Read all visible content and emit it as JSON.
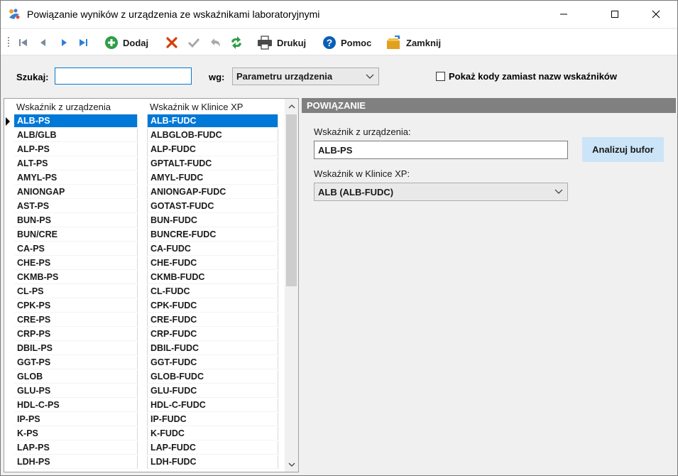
{
  "window": {
    "title": "Powiązanie wyników z urządzenia ze wskaźnikami laboratoryjnymi"
  },
  "toolbar": {
    "add_label": "Dodaj",
    "print_label": "Drukuj",
    "help_label": "Pomoc",
    "close_label": "Zamknij"
  },
  "search": {
    "label": "Szukaj:",
    "value": "",
    "by_label": "wg:",
    "by_value": "Parametru urządzenia",
    "show_codes_label": "Pokaż kody zamiast nazw wskaźników",
    "show_codes_checked": false
  },
  "grid": {
    "columns": [
      "Wskaźnik z urządzenia",
      "Wskaźnik w Klinice XP"
    ],
    "selected_index": 0,
    "rows": [
      [
        "ALB-PS",
        "ALB-FUDC"
      ],
      [
        "ALB/GLB",
        "ALBGLOB-FUDC"
      ],
      [
        "ALP-PS",
        "ALP-FUDC"
      ],
      [
        "ALT-PS",
        "GPTALT-FUDC"
      ],
      [
        "AMYL-PS",
        "AMYL-FUDC"
      ],
      [
        "ANIONGAP",
        "ANIONGAP-FUDC"
      ],
      [
        "AST-PS",
        "GOTAST-FUDC"
      ],
      [
        "BUN-PS",
        "BUN-FUDC"
      ],
      [
        "BUN/CRE",
        "BUNCRE-FUDC"
      ],
      [
        "CA-PS",
        "CA-FUDC"
      ],
      [
        "CHE-PS",
        "CHE-FUDC"
      ],
      [
        "CKMB-PS",
        "CKMB-FUDC"
      ],
      [
        "CL-PS",
        "CL-FUDC"
      ],
      [
        "CPK-PS",
        "CPK-FUDC"
      ],
      [
        "CRE-PS",
        "CRE-FUDC"
      ],
      [
        "CRP-PS",
        "CRP-FUDC"
      ],
      [
        "DBIL-PS",
        "DBIL-FUDC"
      ],
      [
        "GGT-PS",
        "GGT-FUDC"
      ],
      [
        "GLOB",
        "GLOB-FUDC"
      ],
      [
        "GLU-PS",
        "GLU-FUDC"
      ],
      [
        "HDL-C-PS",
        "HDL-C-FUDC"
      ],
      [
        "IP-PS",
        "IP-FUDC"
      ],
      [
        "K-PS",
        "K-FUDC"
      ],
      [
        "LAP-PS",
        "LAP-FUDC"
      ],
      [
        "LDH-PS",
        "LDH-FUDC"
      ]
    ]
  },
  "panel": {
    "header": "POWIĄZANIE",
    "device_label": "Wskaźnik z urządzenia:",
    "device_value": "ALB-PS",
    "clinic_label": "Wskaźnik w Klinice XP:",
    "clinic_value": "ALB (ALB-FUDC)",
    "analyze_label": "Analizuj bufor"
  },
  "colors": {
    "selection": "#0078d7",
    "panel_header": "#808080",
    "button_accent": "#cce4f7",
    "delete_icon": "#d83b01",
    "add_icon": "#2e9e44",
    "help_icon": "#0a5eb8"
  }
}
